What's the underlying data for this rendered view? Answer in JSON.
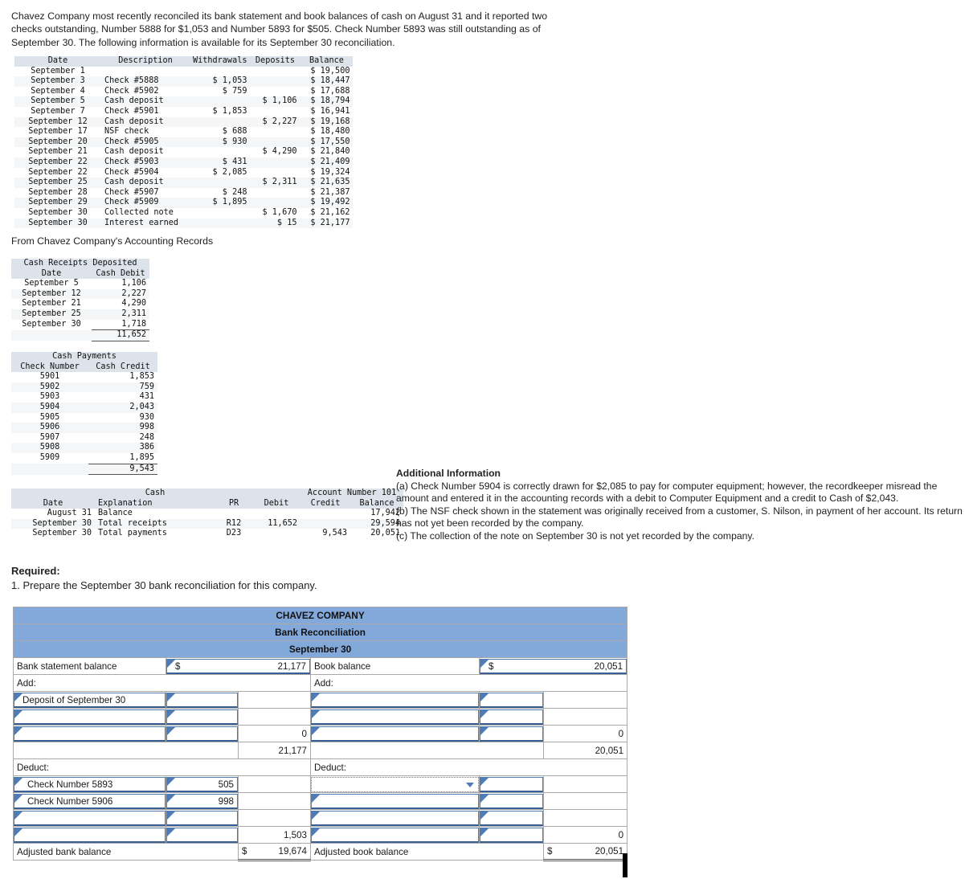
{
  "intro": "Chavez Company most recently reconciled its bank statement and book balances of cash on August 31 and it reported two checks outstanding, Number 5888 for $1,053 and Number 5893 for $505. Check Number 5893 was still outstanding as of September 30. The following information is available for its September 30 reconciliation.",
  "records_label": "From Chavez Company's Accounting Records",
  "bank_statement": {
    "headers": [
      "Date",
      "Description",
      "Withdrawals",
      "Deposits",
      "Balance"
    ],
    "rows": [
      [
        "September 1",
        "",
        "",
        "",
        "$ 19,500"
      ],
      [
        "September 3",
        "Check #5888",
        "$ 1,053",
        "",
        "$ 18,447"
      ],
      [
        "September 4",
        "Check #5902",
        "$ 759",
        "",
        "$ 17,688"
      ],
      [
        "September 5",
        "Cash deposit",
        "",
        "$ 1,106",
        "$ 18,794"
      ],
      [
        "September 7",
        "Check #5901",
        "$ 1,853",
        "",
        "$ 16,941"
      ],
      [
        "September 12",
        "Cash deposit",
        "",
        "$ 2,227",
        "$ 19,168"
      ],
      [
        "September 17",
        "NSF check",
        "$ 688",
        "",
        "$ 18,480"
      ],
      [
        "September 20",
        "Check #5905",
        "$ 930",
        "",
        "$ 17,550"
      ],
      [
        "September 21",
        "Cash deposit",
        "",
        "$ 4,290",
        "$ 21,840"
      ],
      [
        "September 22",
        "Check #5903",
        "$ 431",
        "",
        "$ 21,409"
      ],
      [
        "September 22",
        "Check #5904",
        "$ 2,085",
        "",
        "$ 19,324"
      ],
      [
        "September 25",
        "Cash deposit",
        "",
        "$ 2,311",
        "$ 21,635"
      ],
      [
        "September 28",
        "Check #5907",
        "$ 248",
        "",
        "$ 21,387"
      ],
      [
        "September 29",
        "Check #5909",
        "$ 1,895",
        "",
        "$ 19,492"
      ],
      [
        "September 30",
        "Collected note",
        "",
        "$ 1,670",
        "$ 21,162"
      ],
      [
        "September 30",
        "Interest earned",
        "",
        "$ 15",
        "$ 21,177"
      ]
    ]
  },
  "cash_receipts": {
    "title": "Cash Receipts Deposited",
    "headers": [
      "Date",
      "Cash Debit"
    ],
    "rows": [
      [
        "September 5",
        "1,106"
      ],
      [
        "September 12",
        "2,227"
      ],
      [
        "September 21",
        "4,290"
      ],
      [
        "September 25",
        "2,311"
      ],
      [
        "September 30",
        "1,718"
      ]
    ],
    "total": "11,652"
  },
  "cash_payments": {
    "title": "Cash Payments",
    "headers": [
      "Check Number",
      "Cash Credit"
    ],
    "rows": [
      [
        "5901",
        "1,853"
      ],
      [
        "5902",
        "759"
      ],
      [
        "5903",
        "431"
      ],
      [
        "5904",
        "2,043"
      ],
      [
        "5905",
        "930"
      ],
      [
        "5906",
        "998"
      ],
      [
        "5907",
        "248"
      ],
      [
        "5908",
        "386"
      ],
      [
        "5909",
        "1,895"
      ]
    ],
    "total": "9,543"
  },
  "cash_ledger": {
    "title": "Cash",
    "account_number": "Account Number 101",
    "headers": [
      "Date",
      "Explanation",
      "PR",
      "Debit",
      "Credit",
      "Balance"
    ],
    "rows": [
      [
        "August 31",
        "Balance",
        "",
        "",
        "",
        "17,942"
      ],
      [
        "September 30",
        "Total receipts",
        "R12",
        "11,652",
        "",
        "29,594"
      ],
      [
        "September 30",
        "Total payments",
        "D23",
        "",
        "9,543",
        "20,051"
      ]
    ]
  },
  "additional_information": {
    "heading": "Additional Information",
    "items": [
      "(a) Check Number 5904 is correctly drawn for $2,085 to pay for computer equipment; however, the recordkeeper misread the amount and entered it in the accounting records with a debit to Computer Equipment and a credit to Cash of $2,043.",
      "(b) The NSF check shown in the statement was originally received from a customer, S. Nilson, in payment of her account. Its return has not yet been recorded by the company.",
      "(c) The collection of the note on September 30 is not yet recorded by the company."
    ]
  },
  "required": {
    "heading": "Required:",
    "item": "1. Prepare the September 30 bank reconciliation for this company."
  },
  "reconciliation": {
    "header_company": "CHAVEZ COMPANY",
    "header_statement": "Bank Reconciliation",
    "header_date": "September 30",
    "bank": {
      "balance_label": "Bank statement balance",
      "balance_currency": "$",
      "balance_value": "21,177",
      "add_label": "Add:",
      "add_rows": [
        {
          "desc": "Deposit of September 30",
          "amount": "",
          "total": ""
        },
        {
          "desc": "",
          "amount": "",
          "total": ""
        },
        {
          "desc": "",
          "amount": "",
          "total": "0"
        }
      ],
      "subtotal": "21,177",
      "deduct_label": "Deduct:",
      "deduct_rows": [
        {
          "desc": "Check Number 5893",
          "amount": "505",
          "total": ""
        },
        {
          "desc": "Check Number 5906",
          "amount": "998",
          "total": ""
        },
        {
          "desc": "",
          "amount": "",
          "total": ""
        },
        {
          "desc": "",
          "amount": "",
          "total": "1,503"
        }
      ],
      "adjusted_label": "Adjusted bank balance",
      "adjusted_currency": "$",
      "adjusted_value": "19,674"
    },
    "book": {
      "balance_label": "Book balance",
      "balance_currency": "$",
      "balance_value": "20,051",
      "add_label": "Add:",
      "add_rows": [
        {
          "desc": "",
          "amount": "",
          "total": ""
        },
        {
          "desc": "",
          "amount": "",
          "total": ""
        },
        {
          "desc": "",
          "amount": "",
          "total": "0"
        }
      ],
      "subtotal": "20,051",
      "deduct_label": "Deduct:",
      "deduct_rows": [
        {
          "desc": "",
          "amount": "",
          "total": "",
          "dropdown": true
        },
        {
          "desc": "",
          "amount": "",
          "total": ""
        },
        {
          "desc": "",
          "amount": "",
          "total": ""
        },
        {
          "desc": "",
          "amount": "",
          "total": "0"
        }
      ],
      "adjusted_label": "Adjusted book balance",
      "adjusted_currency": "$",
      "adjusted_value": "20,051"
    }
  },
  "colors": {
    "header_blue": "#82a9da",
    "table_header_gray": "#dde3ea",
    "field_border_blue": "#4f7cb5"
  }
}
